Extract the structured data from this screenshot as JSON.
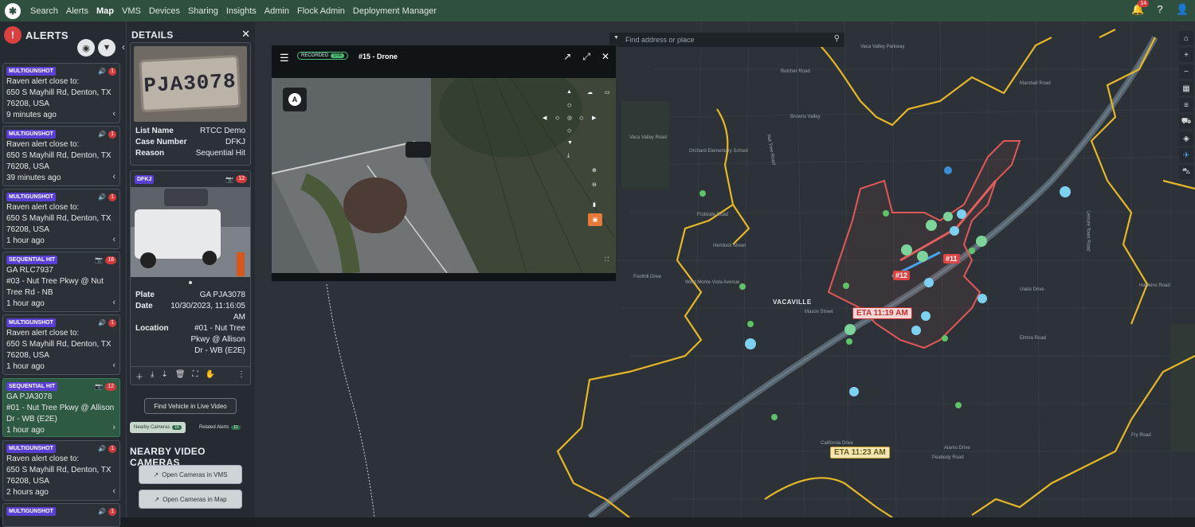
{
  "nav": {
    "items": [
      "Search",
      "Alerts",
      "Map",
      "VMS",
      "Devices",
      "Sharing",
      "Insights",
      "Admin",
      "Flock Admin",
      "Deployment Manager"
    ],
    "active": "Map",
    "notif_count": "14"
  },
  "alerts": {
    "title": "ALERTS",
    "cards": [
      {
        "tag": "MULTIGUNSHOT",
        "count": "1",
        "line1": "Raven alert close to:",
        "line2": "650 S Mayhill Rd, Denton, TX",
        "line3": "76208, USA",
        "time": "9 minutes ago"
      },
      {
        "tag": "MULTIGUNSHOT",
        "count": "1",
        "line1": "Raven alert close to:",
        "line2": "650 S Mayhill Rd, Denton, TX",
        "line3": "76208, USA",
        "time": "39 minutes ago"
      },
      {
        "tag": "MULTIGUNSHOT",
        "count": "1",
        "line1": "Raven alert close to:",
        "line2": "650 S Mayhill Rd, Denton, TX",
        "line3": "76208, USA",
        "time": "1 hour ago"
      },
      {
        "tag": "SEQUENTIAL HIT",
        "count": "18",
        "line1": "GA RLC7937",
        "line2": "#03 - Nut Tree Pkwy @ Nut",
        "line3": "Tree Rd - NB",
        "time": "1 hour ago"
      },
      {
        "tag": "MULTIGUNSHOT",
        "count": "1",
        "line1": "Raven alert close to:",
        "line2": "650 S Mayhill Rd, Denton, TX",
        "line3": "76208, USA",
        "time": "1 hour ago"
      },
      {
        "tag": "SEQUENTIAL HIT",
        "count": "12",
        "line1": "GA PJA3078",
        "line2": "#01 - Nut Tree Pkwy @ Allison",
        "line3": "Dr - WB (E2E)",
        "time": "1 hour ago"
      },
      {
        "tag": "MULTIGUNSHOT",
        "count": "1",
        "line1": "Raven alert close to:",
        "line2": "650 S Mayhill Rd, Denton, TX",
        "line3": "76208, USA",
        "time": "2 hours ago"
      },
      {
        "tag": "MULTIGUNSHOT",
        "count": "1",
        "line1": "",
        "line2": "",
        "line3": "",
        "time": ""
      }
    ]
  },
  "details": {
    "title": "DETAILS",
    "plate_image_text": "PJA3078",
    "list_name_label": "List Name",
    "list_name": "RTCC Demo",
    "case_label": "Case Number",
    "case": "DFKJ",
    "reason_label": "Reason",
    "reason": "Sequential Hit",
    "card_tag": "DFKJ",
    "card_count": "12",
    "plate_label": "Plate",
    "plate": "GA PJA3078",
    "date_label": "Date",
    "date": "10/30/2023, 11:16:05 AM",
    "location_label": "Location",
    "location": "#01 - Nut Tree Pkwy @ Allison Dr - WB (E2E)",
    "find_button": "Find Vehicle in Live Video",
    "tab_nearby": "Nearby Cameras",
    "tab_nearby_count": "15",
    "tab_related": "Related Alerts",
    "tab_related_count": "11",
    "nearby_title": "NEARBY VIDEO CAMERAS",
    "open_vms": "Open Cameras in VMS",
    "open_map": "Open Cameras in Map"
  },
  "video": {
    "recorded": "RECORDED",
    "live": "LIVE",
    "title": "#15 - Drone"
  },
  "map": {
    "search_placeholder": "Find address or place",
    "city": "VACAVILLE",
    "eta_red": "ETA 11:19 AM",
    "eta_yellow": "ETA 11:23 AM",
    "unit1": "#11",
    "unit2": "#12",
    "labels": [
      "Nut Tree Road",
      "Vaca Valley Parkway",
      "Hemlock Street",
      "Elmira Road",
      "Peabody Road",
      "Alamo Drive",
      "Leisure Town Road",
      "Browns Valley",
      "Orchard Elementary School",
      "Fruitvale Road",
      "West Monte Vista Avenue",
      "Foothill Drive",
      "Mason Street",
      "Ulatis Drive",
      "Hawkins Road",
      "California Drive",
      "Fry Road",
      "Vaca Valley Road",
      "Butcher Road",
      "Marshall Road"
    ]
  }
}
